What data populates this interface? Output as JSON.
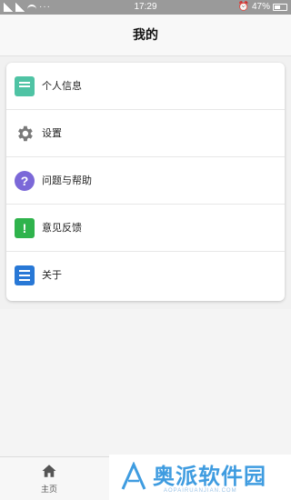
{
  "status_bar": {
    "time": "17:29",
    "battery": "47%",
    "dots": "···"
  },
  "header": {
    "title": "我的"
  },
  "menu": {
    "items": [
      {
        "label": "个人信息",
        "icon": "personal-info-icon",
        "color": "#4fc3a4"
      },
      {
        "label": "设置",
        "icon": "gear-icon",
        "color": "#7a7a7a"
      },
      {
        "label": "问题与帮助",
        "icon": "help-icon",
        "color": "#7b68d8",
        "glyph": "?"
      },
      {
        "label": "意见反馈",
        "icon": "feedback-icon",
        "color": "#2fb34c",
        "glyph": "!"
      },
      {
        "label": "关于",
        "icon": "about-icon",
        "color": "#2878d6"
      }
    ]
  },
  "tabbar": {
    "home_label": "主页"
  },
  "watermark": {
    "text": "奥派软件园",
    "sub": "AOPAIRUANJIAN.COM"
  }
}
